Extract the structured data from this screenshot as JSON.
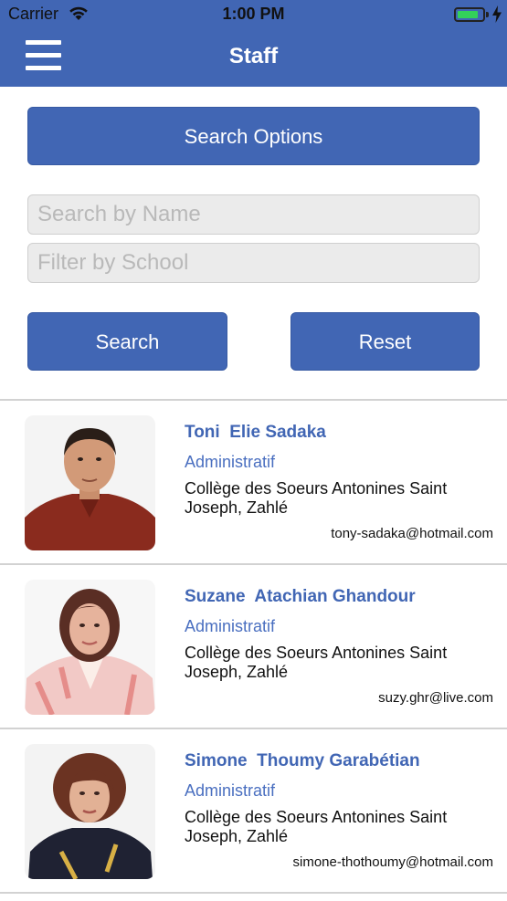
{
  "status_bar": {
    "carrier": "Carrier",
    "time": "1:00 PM",
    "battery_level": 0.85,
    "battery_color": "#33d15a"
  },
  "nav": {
    "title": "Staff",
    "menu_icon": "hamburger-menu-icon",
    "color": "#4166b4"
  },
  "search": {
    "options_label": "Search Options",
    "name_placeholder": "Search by Name",
    "school_placeholder": "Filter by School",
    "search_label": "Search",
    "reset_label": "Reset"
  },
  "staff": [
    {
      "name": "Toni  Elie Sadaka",
      "role": "Administratif",
      "school": "Collège des Soeurs Antonines Saint Joseph, Zahlé",
      "email": "tony-sadaka@hotmail.com"
    },
    {
      "name": "Suzane  Atachian Ghandour",
      "role": "Administratif",
      "school": "Collège des Soeurs Antonines Saint Joseph, Zahlé",
      "email": "suzy.ghr@live.com"
    },
    {
      "name": "Simone  Thoumy Garabétian",
      "role": "Administratif",
      "school": "Collège des Soeurs Antonines Saint Joseph, Zahlé",
      "email": "simone-thothoumy@hotmail.com"
    }
  ]
}
